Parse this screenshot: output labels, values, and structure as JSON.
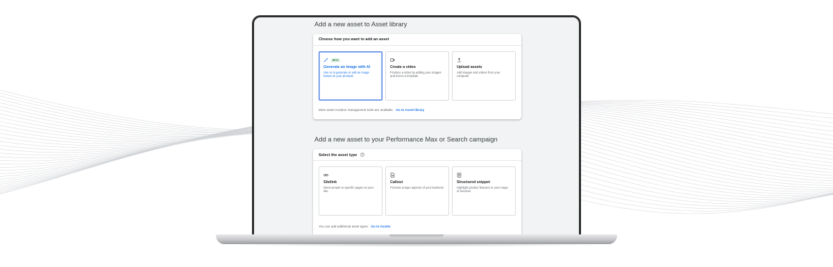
{
  "section1": {
    "title": "Add a new asset to Asset library",
    "card_header": "Choose how you want to add an asset",
    "options": [
      {
        "icon": "magic-wand-icon",
        "badge": "BETA",
        "title": "Generate an image with AI",
        "desc": "Use AI to generate or edit an image based on your prompts",
        "selected": true
      },
      {
        "icon": "video-camera-icon",
        "title": "Create a video",
        "desc": "Produce a video by adding your images and text to a template"
      },
      {
        "icon": "upload-icon",
        "title": "Upload assets",
        "desc": "Add images and videos from your computer"
      }
    ],
    "footer_text": "More asset creation management tools are available.",
    "footer_link": "Go to Asset library"
  },
  "section2": {
    "title": "Add a new asset to your Performance Max or Search campaign",
    "card_header": "Select the asset type",
    "options": [
      {
        "icon": "link-icon",
        "title": "Sitelink",
        "desc": "Direct people to specific pages on your site"
      },
      {
        "icon": "callout-icon",
        "title": "Callout",
        "desc": "Promote unique aspects of your business"
      },
      {
        "icon": "snippet-icon",
        "title": "Structured snippet",
        "desc": "Highlight product features or your range of services"
      }
    ],
    "footer_text": "You can add additional asset types.",
    "footer_link": "Go to Assets"
  },
  "colors": {
    "accent": "#1a73e8",
    "selected_border": "#4a7fe0",
    "beta_text": "#137333",
    "beta_bg": "#e6f4ea"
  }
}
